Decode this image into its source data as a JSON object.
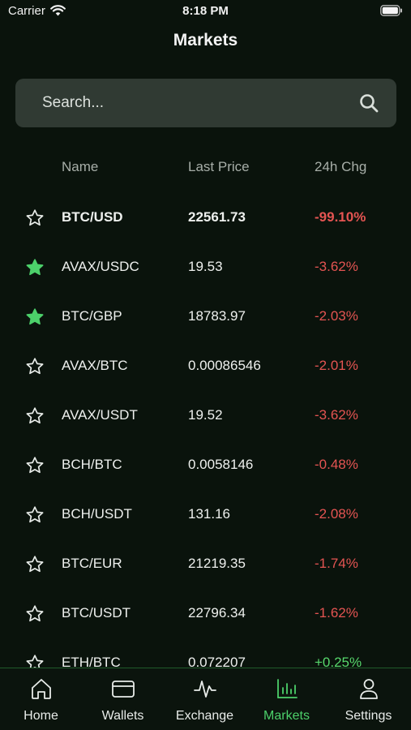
{
  "status_bar": {
    "carrier": "Carrier",
    "time": "8:18 PM"
  },
  "header": {
    "title": "Markets"
  },
  "search": {
    "placeholder": "Search..."
  },
  "table": {
    "columns": {
      "name": "Name",
      "last_price": "Last Price",
      "change": "24h Chg"
    },
    "rows": [
      {
        "pair": "BTC/USD",
        "price": "22561.73",
        "change": "-99.10%",
        "favorite": false,
        "direction": "down",
        "bold": true
      },
      {
        "pair": "AVAX/USDC",
        "price": "19.53",
        "change": "-3.62%",
        "favorite": true,
        "direction": "down",
        "bold": false
      },
      {
        "pair": "BTC/GBP",
        "price": "18783.97",
        "change": "-2.03%",
        "favorite": true,
        "direction": "down",
        "bold": false
      },
      {
        "pair": "AVAX/BTC",
        "price": "0.00086546",
        "change": "-2.01%",
        "favorite": false,
        "direction": "down",
        "bold": false
      },
      {
        "pair": "AVAX/USDT",
        "price": "19.52",
        "change": "-3.62%",
        "favorite": false,
        "direction": "down",
        "bold": false
      },
      {
        "pair": "BCH/BTC",
        "price": "0.0058146",
        "change": "-0.48%",
        "favorite": false,
        "direction": "down",
        "bold": false
      },
      {
        "pair": "BCH/USDT",
        "price": "131.16",
        "change": "-2.08%",
        "favorite": false,
        "direction": "down",
        "bold": false
      },
      {
        "pair": "BTC/EUR",
        "price": "21219.35",
        "change": "-1.74%",
        "favorite": false,
        "direction": "down",
        "bold": false
      },
      {
        "pair": "BTC/USDT",
        "price": "22796.34",
        "change": "-1.62%",
        "favorite": false,
        "direction": "down",
        "bold": false
      },
      {
        "pair": "ETH/BTC",
        "price": "0.072207",
        "change": "+0.25%",
        "favorite": false,
        "direction": "up",
        "bold": false
      }
    ]
  },
  "tab_bar": {
    "tabs": [
      {
        "label": "Home",
        "icon": "home-icon",
        "active": false
      },
      {
        "label": "Wallets",
        "icon": "wallet-icon",
        "active": false
      },
      {
        "label": "Exchange",
        "icon": "pulse-icon",
        "active": false
      },
      {
        "label": "Markets",
        "icon": "bar-chart-icon",
        "active": true
      },
      {
        "label": "Settings",
        "icon": "person-icon",
        "active": false
      }
    ]
  },
  "colors": {
    "background": "#0a130c",
    "accent_green": "#4cd06a",
    "negative_red": "#e45452",
    "search_bg": "#303a33"
  }
}
